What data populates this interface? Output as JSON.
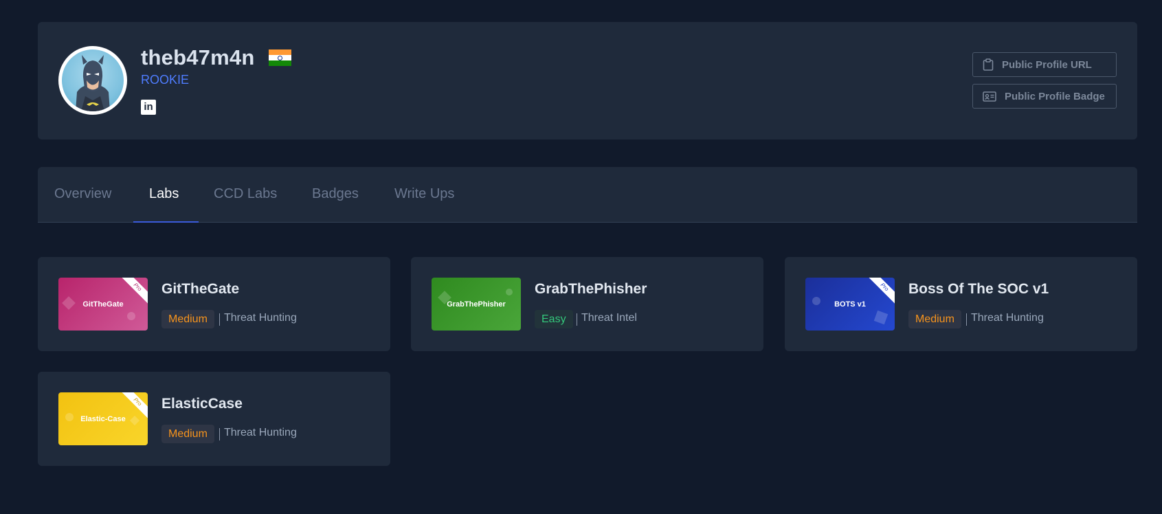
{
  "profile": {
    "username": "theb47m4n",
    "rank": "ROOKIE",
    "country_flag": "india-flag",
    "social": "linkedin-icon",
    "buttons": {
      "public_url": "Public Profile URL",
      "public_badge": "Public Profile Badge"
    }
  },
  "tabs": [
    {
      "label": "Overview",
      "active": false
    },
    {
      "label": "Labs",
      "active": true
    },
    {
      "label": "CCD Labs",
      "active": false
    },
    {
      "label": "Badges",
      "active": false
    },
    {
      "label": "Write Ups",
      "active": false
    }
  ],
  "labs": [
    {
      "title": "GitTheGate",
      "thumb_text": "GitTheGate",
      "pro": true,
      "difficulty": "Medium",
      "category": "Threat Hunting",
      "color": "#c2357a"
    },
    {
      "title": "GrabThePhisher",
      "thumb_text": "GrabThePhisher",
      "pro": false,
      "difficulty": "Easy",
      "category": "Threat Intel",
      "color": "#3a9a2a"
    },
    {
      "title": "Boss Of The SOC v1",
      "thumb_text": "BOTS v1",
      "pro": true,
      "difficulty": "Medium",
      "category": "Threat Hunting",
      "color": "#1f3ec4"
    },
    {
      "title": "ElasticCase",
      "thumb_text": "Elastic-Case",
      "pro": true,
      "difficulty": "Medium",
      "category": "Threat Hunting",
      "color": "#f6c914"
    }
  ],
  "pro_label": "Pro",
  "colors": {
    "background": "#111a2b",
    "card": "#1f2a3b",
    "accent": "#4f7dff",
    "medium": "#f7941d",
    "easy": "#34c77b"
  }
}
